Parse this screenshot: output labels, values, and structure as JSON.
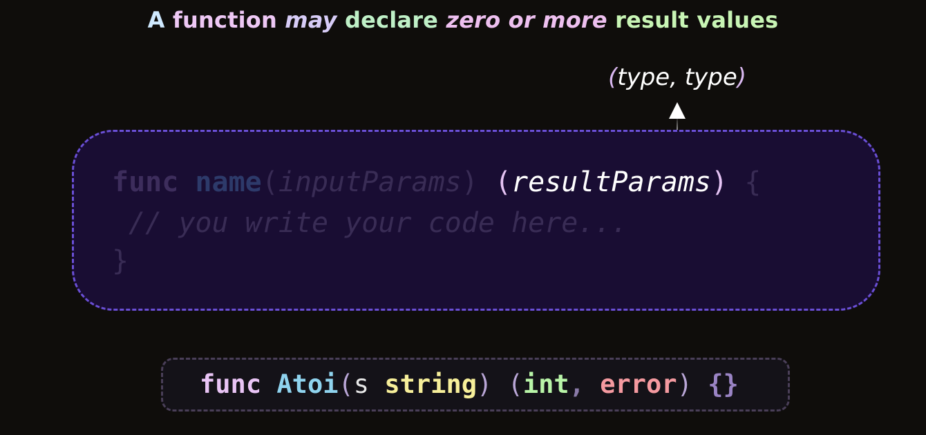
{
  "headline": {
    "part1": "A",
    "part2": " function ",
    "part3": "may",
    "part4": " declare ",
    "part5": "zero or more",
    "part6": " result values"
  },
  "annotation": {
    "open_paren": "(",
    "text": "type, type",
    "close_paren": ")"
  },
  "signature": {
    "keyword": "func",
    "name": "name",
    "input_open": "(",
    "input_params": "inputParams",
    "input_close": ")",
    "result_open": "(",
    "result_params": "resultParams",
    "result_close": ")",
    "brace_open": "{",
    "comment": "// you write your code here...",
    "brace_close": "}"
  },
  "example": {
    "keyword": "func",
    "name": "Atoi",
    "open_paren": "(",
    "param_name": "s",
    "param_type": "string",
    "close_paren": ")",
    "result_open": "(",
    "result_type1": "int",
    "comma": ",",
    "result_type2": "error",
    "result_close": ")",
    "body": "{}"
  },
  "colors": {
    "background": "#0f0d0b",
    "box_border": "#6a4fd6",
    "box_fill": "#190d33",
    "keyword": "#e9c4f5",
    "func_name": "#8fd3ee",
    "param_type": "#f7ef9a",
    "int_type": "#b9f5a8",
    "error_type": "#f59aa0"
  },
  "icons": [
    "up-arrow-icon"
  ]
}
